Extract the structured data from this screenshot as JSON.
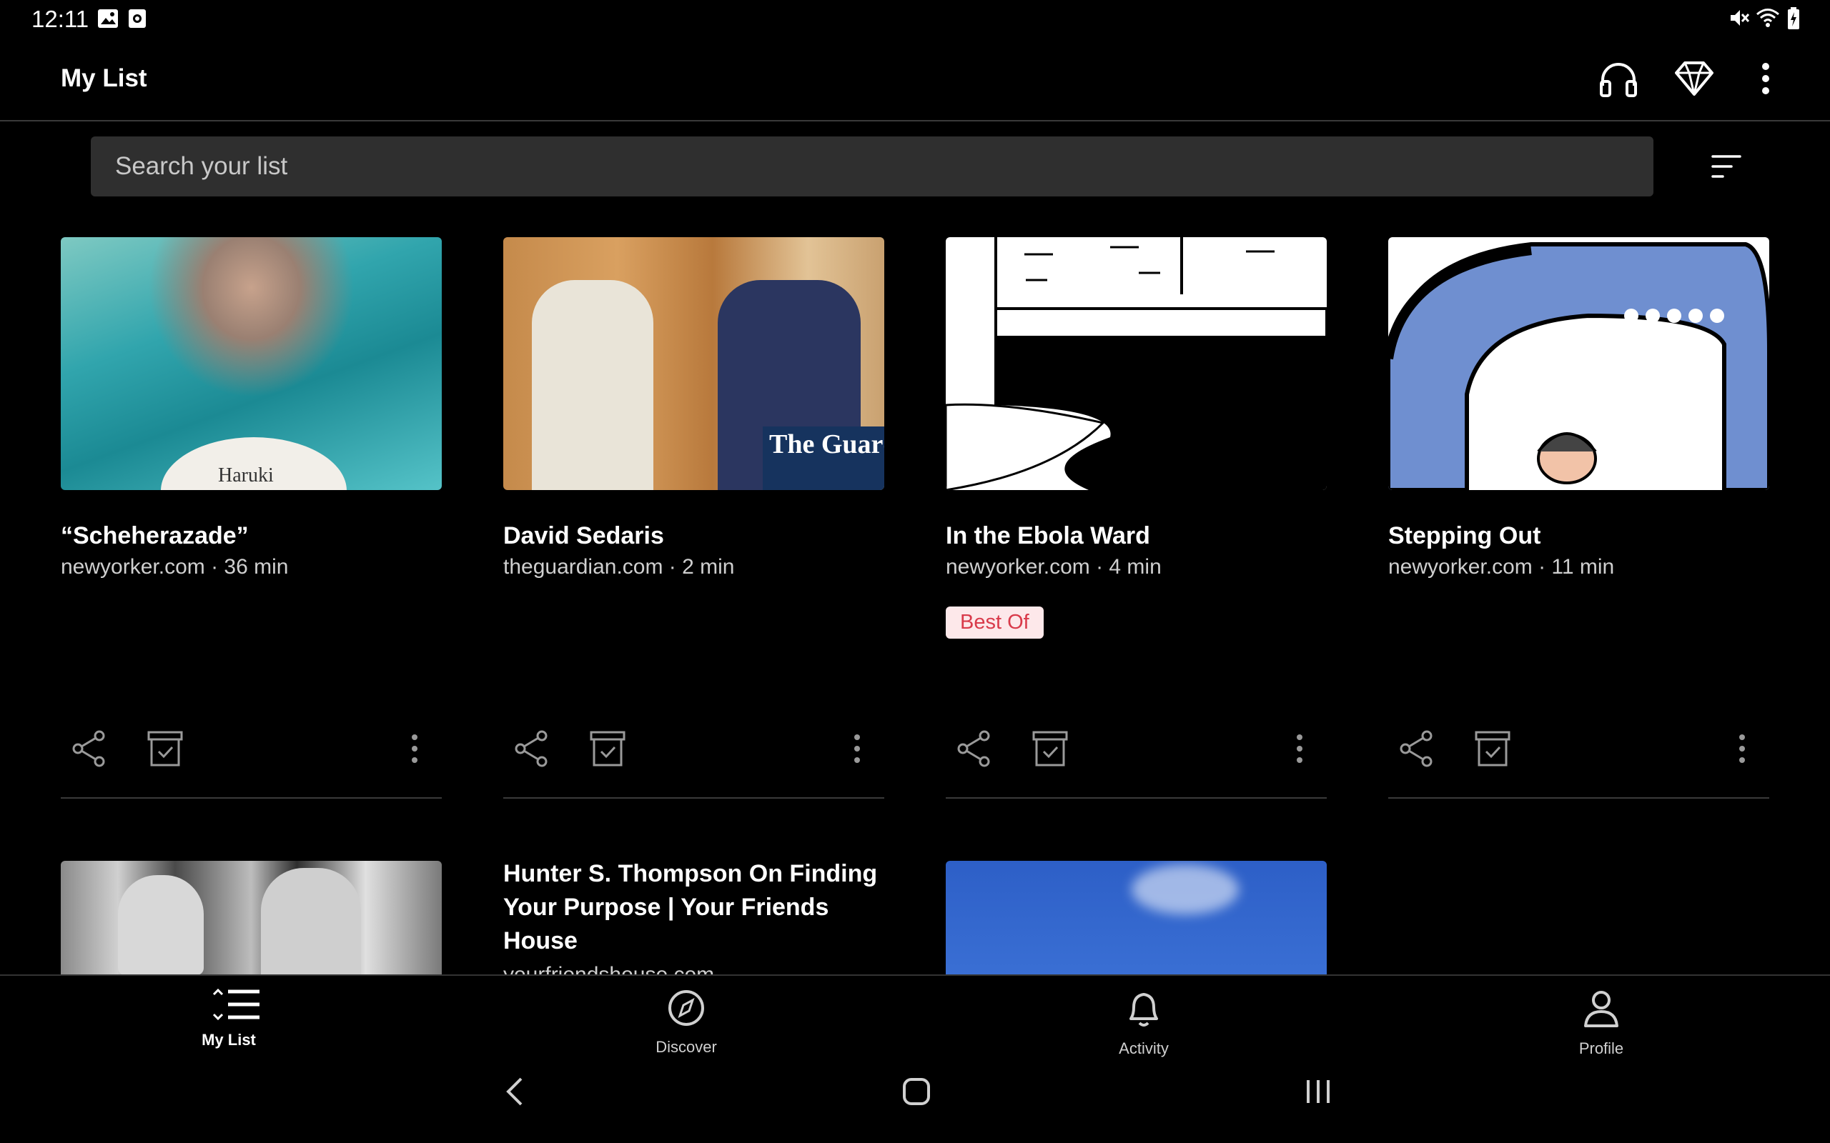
{
  "status_bar": {
    "time": "12:11",
    "left_icons": [
      "image-icon",
      "camera-notification-icon"
    ],
    "right_icons": [
      "mute-icon",
      "wifi-icon",
      "battery-charging-icon"
    ]
  },
  "header": {
    "title": "My List",
    "actions": [
      "headphones-icon",
      "premium-diamond-icon",
      "overflow-menu-icon"
    ]
  },
  "search": {
    "placeholder": "Search your list"
  },
  "sort_icon": "sort-icon",
  "cards": [
    {
      "title": "“Scheherazade”",
      "meta": "newyorker.com · 36 min",
      "thumb_text": "Haruki"
    },
    {
      "title": "David Sedaris",
      "meta": "theguardian.com · 2 min",
      "thumb_text": "The Guardia"
    },
    {
      "title": "In the Ebola Ward",
      "meta": "newyorker.com · 4 min",
      "badge": "Best Of"
    },
    {
      "title": "Stepping Out",
      "meta": "newyorker.com · 11 min"
    },
    {
      "title": "",
      "meta": ""
    },
    {
      "title": "Hunter S. Thompson On Finding Your Purpose | Your Friends House",
      "meta": "yourfriendshouse.com"
    },
    {
      "title": "",
      "meta": ""
    }
  ],
  "bottom_nav": {
    "items": [
      {
        "label": "My List",
        "icon": "list-icon",
        "active": true
      },
      {
        "label": "Discover",
        "icon": "compass-icon",
        "active": false
      },
      {
        "label": "Activity",
        "icon": "bell-icon",
        "active": false
      },
      {
        "label": "Profile",
        "icon": "person-icon",
        "active": false
      }
    ]
  },
  "system_nav": [
    "back-icon",
    "home-icon",
    "recents-icon"
  ],
  "colors": {
    "background": "#000000",
    "search_bg": "#2f2f2f",
    "badge_bg": "#fde8ea",
    "badge_text": "#d93a4a",
    "divider": "#3a3a3a"
  }
}
